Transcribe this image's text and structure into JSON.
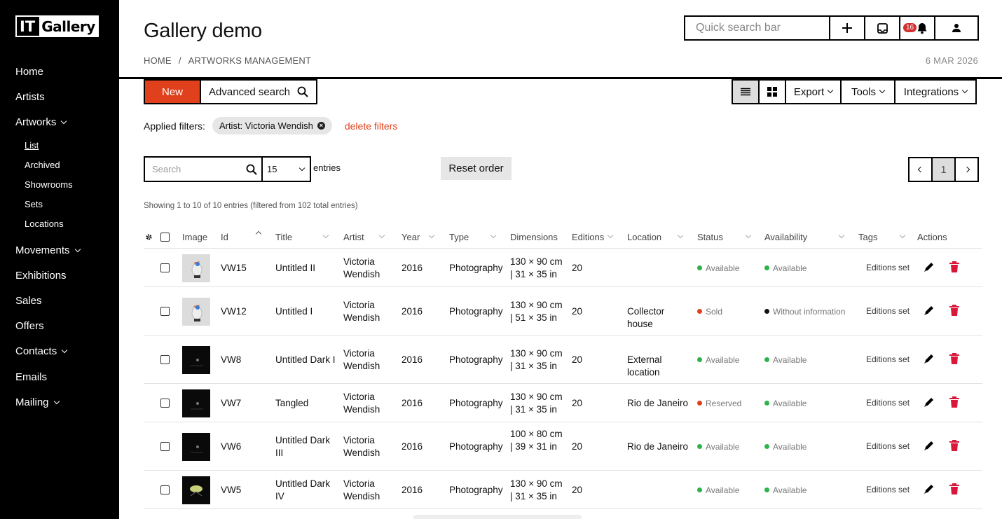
{
  "sidebar": {
    "logo": {
      "it": "IT",
      "gallery": "Gallery"
    },
    "items": [
      {
        "label": "Home"
      },
      {
        "label": "Artists"
      },
      {
        "label": "Artworks"
      },
      {
        "label": "Movements"
      },
      {
        "label": "Exhibitions"
      },
      {
        "label": "Sales"
      },
      {
        "label": "Offers"
      },
      {
        "label": "Contacts"
      },
      {
        "label": "Emails"
      },
      {
        "label": "Mailing"
      }
    ],
    "artworks_sub": [
      {
        "label": "List"
      },
      {
        "label": "Archived"
      },
      {
        "label": "Showrooms"
      },
      {
        "label": "Sets"
      },
      {
        "label": "Locations"
      }
    ]
  },
  "header": {
    "title": "Gallery demo",
    "breadcrumb": [
      "HOME",
      "/",
      "ARTWORKS MANAGEMENT"
    ],
    "date": "6 MAR 2026",
    "quick_search_placeholder": "Quick search bar",
    "notifications_count": "16"
  },
  "toolbar": {
    "new_label": "New",
    "advanced_search_label": "Advanced search",
    "export_label": "Export",
    "tools_label": "Tools",
    "integrations_label": "Integrations"
  },
  "filters": {
    "label": "Applied filters:",
    "chip": "Artist: Victoria Wendish",
    "delete_label": "delete filters"
  },
  "list_controls": {
    "search_placeholder": "Search",
    "entries_value": "15",
    "entries_label": "entries",
    "reset_label": "Reset order",
    "page": "1",
    "showing": "Showing 1 to 10 of 10 entries (filtered from 102 total entries)"
  },
  "table": {
    "headers": [
      "Image",
      "Id",
      "Title",
      "Artist",
      "Year",
      "Type",
      "Dimensions",
      "Editions",
      "Location",
      "Status",
      "Availability",
      "Tags",
      "Actions"
    ],
    "rows": [
      {
        "id": "VW15",
        "title": "Untitled II",
        "artist": "Victoria Wendish",
        "year": "2016",
        "type": "Photography",
        "dimensions": "130 × 90 cm | 31 × 35 in",
        "editions": "20",
        "location": "",
        "status": "Available",
        "status_color": "#2db34a",
        "availability": "Available",
        "availability_color": "#2db34a",
        "tags": "Editions set",
        "thumb": "light-bird"
      },
      {
        "id": "VW12",
        "title": "Untitled I",
        "artist": "Victoria Wendish",
        "year": "2016",
        "type": "Photography",
        "dimensions": "130 × 90 cm | 51 × 35 in",
        "editions": "20",
        "location": "Collector house",
        "status": "Sold",
        "status_color": "#e0401c",
        "availability": "Without information",
        "availability_color": "#111111",
        "tags": "Editions set",
        "thumb": "light-bird"
      },
      {
        "id": "VW8",
        "title": "Untitled Dark I",
        "artist": "Victoria Wendish",
        "year": "2016",
        "type": "Photography",
        "dimensions": "130 × 90 cm | 31 × 35 in",
        "editions": "20",
        "location": "External location",
        "status": "Available",
        "status_color": "#2db34a",
        "availability": "Available",
        "availability_color": "#2db34a",
        "tags": "Editions set",
        "thumb": "dark"
      },
      {
        "id": "VW7",
        "title": "Tangled",
        "artist": "Victoria Wendish",
        "year": "2016",
        "type": "Photography",
        "dimensions": "130 × 90 cm | 31 × 35 in",
        "editions": "20",
        "location": "Rio de Janeiro",
        "status": "Reserved",
        "status_color": "#e0401c",
        "availability": "Available",
        "availability_color": "#2db34a",
        "tags": "Editions set",
        "thumb": "dark"
      },
      {
        "id": "VW6",
        "title": "Untitled Dark III",
        "artist": "Victoria Wendish",
        "year": "2016",
        "type": "Photography",
        "dimensions": "100 × 80 cm | 39 × 31 in",
        "editions": "20",
        "location": "Rio de Janeiro",
        "status": "Available",
        "status_color": "#2db34a",
        "availability": "Available",
        "availability_color": "#2db34a",
        "tags": "Editions set",
        "thumb": "dark"
      },
      {
        "id": "VW5",
        "title": "Untitled Dark IV",
        "artist": "Victoria Wendish",
        "year": "2016",
        "type": "Photography",
        "dimensions": "130 × 90 cm | 31 × 35 in",
        "editions": "20",
        "location": "",
        "status": "Available",
        "status_color": "#2db34a",
        "availability": "Available",
        "availability_color": "#2db34a",
        "tags": "Editions set",
        "thumb": "dark-green"
      }
    ]
  },
  "colors": {
    "accent": "#e0401c",
    "danger": "#d9173a",
    "available": "#2db34a"
  }
}
